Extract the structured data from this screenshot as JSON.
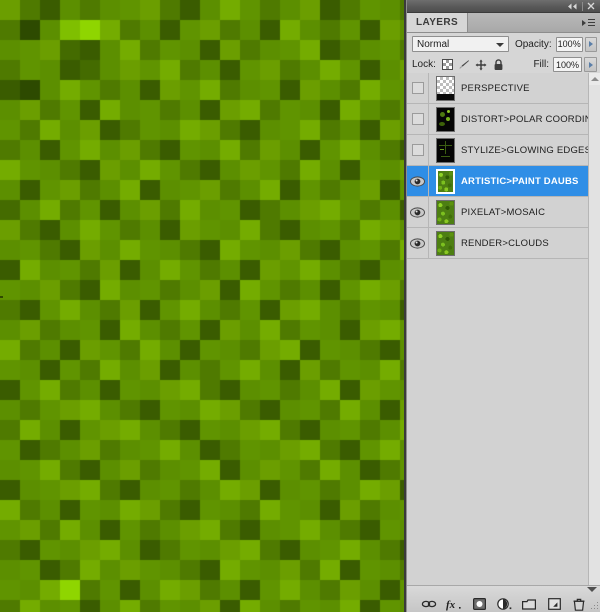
{
  "window": {
    "collapse_icon": "double-left-arrow",
    "close_icon": "close-x"
  },
  "panel": {
    "tab_label": "LAYERS",
    "menu_icon": "panel-menu-icon",
    "blend_mode": "Normal",
    "blend_dropdown_icon": "chevron-down-icon",
    "opacity_label": "Opacity:",
    "opacity_value": "100%",
    "opacity_stepper_icon": "chevron-right-icon",
    "fill_label": "Fill:",
    "fill_value": "100%",
    "fill_stepper_icon": "chevron-right-icon",
    "lock_label": "Lock:",
    "lock_icons": [
      "lock-transparent-pixels-icon",
      "lock-image-pixels-icon",
      "lock-position-icon",
      "lock-all-icon"
    ]
  },
  "layers": [
    {
      "name": "PERSPECTIVE",
      "visible": false,
      "selected": false,
      "thumb": "checker"
    },
    {
      "name": "DISTORT>POLAR COORDINA...",
      "visible": false,
      "selected": false,
      "thumb": "polar"
    },
    {
      "name": "STYLIZE>GLOWING EDGES",
      "visible": false,
      "selected": false,
      "thumb": "glow"
    },
    {
      "name": "ARTISTIC>PAINT DAUBS",
      "visible": true,
      "selected": true,
      "thumb": "green"
    },
    {
      "name": "PIXELAT>MOSAIC",
      "visible": true,
      "selected": false,
      "thumb": "green"
    },
    {
      "name": "RENDER>CLOUDS",
      "visible": true,
      "selected": false,
      "thumb": "green"
    }
  ],
  "bottom_toolbar": {
    "items": [
      "link-layers-icon",
      "layer-style-fx-icon",
      "layer-mask-icon",
      "adjustment-layer-icon",
      "new-group-icon",
      "new-layer-icon",
      "delete-layer-icon"
    ]
  },
  "colors": {
    "selection_blue": "#2f8ee6",
    "panel_bg": "#d6d6d6",
    "list_bg": "#d2d2d2",
    "topbar_dark": "#595959"
  },
  "canvas": {
    "name": "mosaic-image",
    "cell_size": 20,
    "cols": 21,
    "rows": 31,
    "palette": [
      "#6b9e00",
      "#4f7a00",
      "#3a5c00",
      "#7fbf00",
      "#8fd500",
      "#5c8f00",
      "#2d4a00",
      "#74ac00",
      "#446b00",
      "#609400",
      "#86c900",
      "#33520a",
      "#567f00",
      "#6fa300",
      "#90d91a",
      "#2a4400"
    ],
    "grid": [
      [
        "#6b9e00",
        "#4f7a00",
        "#3a5c00",
        "#5c8f00",
        "#4f7a00",
        "#5c8f00",
        "#609400",
        "#6b9e00",
        "#4f7a00",
        "#3a5c00",
        "#5c8f00",
        "#74ac00",
        "#609400",
        "#4f7a00",
        "#5c8f00",
        "#6b9e00",
        "#3a5c00",
        "#4f7a00",
        "#609400",
        "#5c8f00",
        "#4f7a00"
      ],
      [
        "#4f7a00",
        "#2d4a00",
        "#5c8f00",
        "#7fbf00",
        "#8fd500",
        "#74ac00",
        "#4f7a00",
        "#5c8f00",
        "#3a5c00",
        "#609400",
        "#6b9e00",
        "#4f7a00",
        "#5c8f00",
        "#3a5c00",
        "#74ac00",
        "#5c8f00",
        "#4f7a00",
        "#609400",
        "#3a5c00",
        "#6b9e00",
        "#5c8f00"
      ],
      [
        "#5c8f00",
        "#609400",
        "#6b9e00",
        "#446b00",
        "#3a5c00",
        "#5c8f00",
        "#74ac00",
        "#4f7a00",
        "#609400",
        "#5c8f00",
        "#3a5c00",
        "#6b9e00",
        "#4f7a00",
        "#5c8f00",
        "#609400",
        "#74ac00",
        "#3a5c00",
        "#4f7a00",
        "#5c8f00",
        "#609400",
        "#4f7a00"
      ],
      [
        "#4f7a00",
        "#609400",
        "#5c8f00",
        "#3a5c00",
        "#446b00",
        "#5c8f00",
        "#6b9e00",
        "#609400",
        "#74ac00",
        "#4f7a00",
        "#5c8f00",
        "#3a5c00",
        "#609400",
        "#6b9e00",
        "#4f7a00",
        "#5c8f00",
        "#74ac00",
        "#609400",
        "#3a5c00",
        "#5c8f00",
        "#6b9e00"
      ],
      [
        "#3a5c00",
        "#2d4a00",
        "#5c8f00",
        "#74ac00",
        "#609400",
        "#4f7a00",
        "#5c8f00",
        "#3a5c00",
        "#6b9e00",
        "#609400",
        "#74ac00",
        "#4f7a00",
        "#5c8f00",
        "#609400",
        "#3a5c00",
        "#6b9e00",
        "#5c8f00",
        "#4f7a00",
        "#74ac00",
        "#609400",
        "#5c8f00"
      ],
      [
        "#5c8f00",
        "#6b9e00",
        "#4f7a00",
        "#609400",
        "#3a5c00",
        "#74ac00",
        "#5c8f00",
        "#609400",
        "#4f7a00",
        "#5c8f00",
        "#3a5c00",
        "#6b9e00",
        "#74ac00",
        "#4f7a00",
        "#609400",
        "#5c8f00",
        "#3a5c00",
        "#74ac00",
        "#5c8f00",
        "#4f7a00",
        "#609400"
      ],
      [
        "#609400",
        "#4f7a00",
        "#74ac00",
        "#5c8f00",
        "#6b9e00",
        "#3a5c00",
        "#4f7a00",
        "#609400",
        "#5c8f00",
        "#74ac00",
        "#6b9e00",
        "#4f7a00",
        "#3a5c00",
        "#5c8f00",
        "#609400",
        "#74ac00",
        "#4f7a00",
        "#5c8f00",
        "#3a5c00",
        "#6b9e00",
        "#5c8f00"
      ],
      [
        "#4f7a00",
        "#5c8f00",
        "#3a5c00",
        "#609400",
        "#74ac00",
        "#5c8f00",
        "#6b9e00",
        "#4f7a00",
        "#3a5c00",
        "#609400",
        "#5c8f00",
        "#74ac00",
        "#4f7a00",
        "#6b9e00",
        "#5c8f00",
        "#3a5c00",
        "#609400",
        "#74ac00",
        "#5c8f00",
        "#4f7a00",
        "#3a5c00"
      ],
      [
        "#74ac00",
        "#609400",
        "#5c8f00",
        "#4f7a00",
        "#3a5c00",
        "#6b9e00",
        "#5c8f00",
        "#74ac00",
        "#609400",
        "#4f7a00",
        "#3a5c00",
        "#5c8f00",
        "#6b9e00",
        "#609400",
        "#4f7a00",
        "#74ac00",
        "#5c8f00",
        "#3a5c00",
        "#609400",
        "#5c8f00",
        "#6b9e00"
      ],
      [
        "#5c8f00",
        "#3a5c00",
        "#609400",
        "#6b9e00",
        "#4f7a00",
        "#5c8f00",
        "#74ac00",
        "#3a5c00",
        "#5c8f00",
        "#609400",
        "#6b9e00",
        "#4f7a00",
        "#5c8f00",
        "#74ac00",
        "#3a5c00",
        "#609400",
        "#4f7a00",
        "#5c8f00",
        "#6b9e00",
        "#3a5c00",
        "#609400"
      ],
      [
        "#446b00",
        "#5c8f00",
        "#74ac00",
        "#4f7a00",
        "#609400",
        "#3a5c00",
        "#5c8f00",
        "#6b9e00",
        "#4f7a00",
        "#74ac00",
        "#5c8f00",
        "#609400",
        "#3a5c00",
        "#4f7a00",
        "#5c8f00",
        "#6b9e00",
        "#74ac00",
        "#609400",
        "#4f7a00",
        "#5c8f00",
        "#3a5c00"
      ],
      [
        "#6b9e00",
        "#4f7a00",
        "#3a5c00",
        "#5c8f00",
        "#74ac00",
        "#609400",
        "#4f7a00",
        "#5c8f00",
        "#3a5c00",
        "#6b9e00",
        "#609400",
        "#5c8f00",
        "#74ac00",
        "#4f7a00",
        "#3a5c00",
        "#5c8f00",
        "#609400",
        "#4f7a00",
        "#74ac00",
        "#6b9e00",
        "#5c8f00"
      ],
      [
        "#5c8f00",
        "#609400",
        "#4f7a00",
        "#3a5c00",
        "#6b9e00",
        "#5c8f00",
        "#74ac00",
        "#609400",
        "#5c8f00",
        "#4f7a00",
        "#3a5c00",
        "#74ac00",
        "#609400",
        "#5c8f00",
        "#6b9e00",
        "#4f7a00",
        "#3a5c00",
        "#5c8f00",
        "#609400",
        "#4f7a00",
        "#74ac00"
      ],
      [
        "#3a5c00",
        "#74ac00",
        "#5c8f00",
        "#609400",
        "#4f7a00",
        "#6b9e00",
        "#3a5c00",
        "#5c8f00",
        "#74ac00",
        "#609400",
        "#4f7a00",
        "#5c8f00",
        "#3a5c00",
        "#6b9e00",
        "#609400",
        "#74ac00",
        "#5c8f00",
        "#4f7a00",
        "#3a5c00",
        "#5c8f00",
        "#609400"
      ],
      [
        "#609400",
        "#5c8f00",
        "#6b9e00",
        "#4f7a00",
        "#3a5c00",
        "#74ac00",
        "#5c8f00",
        "#609400",
        "#4f7a00",
        "#5c8f00",
        "#6b9e00",
        "#3a5c00",
        "#74ac00",
        "#609400",
        "#4f7a00",
        "#5c8f00",
        "#3a5c00",
        "#609400",
        "#74ac00",
        "#6b9e00",
        "#4f7a00"
      ],
      [
        "#4f7a00",
        "#3a5c00",
        "#609400",
        "#74ac00",
        "#5c8f00",
        "#4f7a00",
        "#6b9e00",
        "#3a5c00",
        "#609400",
        "#74ac00",
        "#5c8f00",
        "#4f7a00",
        "#609400",
        "#3a5c00",
        "#6b9e00",
        "#74ac00",
        "#5c8f00",
        "#4f7a00",
        "#609400",
        "#5c8f00",
        "#3a5c00"
      ],
      [
        "#5c8f00",
        "#6b9e00",
        "#4f7a00",
        "#5c8f00",
        "#609400",
        "#3a5c00",
        "#74ac00",
        "#5c8f00",
        "#4f7a00",
        "#609400",
        "#3a5c00",
        "#6b9e00",
        "#5c8f00",
        "#74ac00",
        "#4f7a00",
        "#609400",
        "#5c8f00",
        "#3a5c00",
        "#6b9e00",
        "#74ac00",
        "#609400"
      ],
      [
        "#74ac00",
        "#4f7a00",
        "#5c8f00",
        "#3a5c00",
        "#6b9e00",
        "#609400",
        "#4f7a00",
        "#74ac00",
        "#5c8f00",
        "#3a5c00",
        "#609400",
        "#5c8f00",
        "#4f7a00",
        "#6b9e00",
        "#74ac00",
        "#3a5c00",
        "#609400",
        "#5c8f00",
        "#4f7a00",
        "#3a5c00",
        "#5c8f00"
      ],
      [
        "#609400",
        "#5c8f00",
        "#3a5c00",
        "#609400",
        "#4f7a00",
        "#74ac00",
        "#5c8f00",
        "#6b9e00",
        "#3a5c00",
        "#5c8f00",
        "#4f7a00",
        "#609400",
        "#74ac00",
        "#5c8f00",
        "#3a5c00",
        "#6b9e00",
        "#4f7a00",
        "#609400",
        "#5c8f00",
        "#74ac00",
        "#4f7a00"
      ],
      [
        "#3a5c00",
        "#609400",
        "#74ac00",
        "#4f7a00",
        "#5c8f00",
        "#3a5c00",
        "#609400",
        "#5c8f00",
        "#6b9e00",
        "#74ac00",
        "#4f7a00",
        "#3a5c00",
        "#5c8f00",
        "#609400",
        "#4f7a00",
        "#5c8f00",
        "#74ac00",
        "#3a5c00",
        "#6b9e00",
        "#609400",
        "#5c8f00"
      ],
      [
        "#5c8f00",
        "#4f7a00",
        "#609400",
        "#6b9e00",
        "#74ac00",
        "#5c8f00",
        "#4f7a00",
        "#3a5c00",
        "#609400",
        "#5c8f00",
        "#74ac00",
        "#6b9e00",
        "#4f7a00",
        "#3a5c00",
        "#5c8f00",
        "#609400",
        "#4f7a00",
        "#74ac00",
        "#5c8f00",
        "#3a5c00",
        "#6b9e00"
      ],
      [
        "#4f7a00",
        "#74ac00",
        "#5c8f00",
        "#3a5c00",
        "#609400",
        "#6b9e00",
        "#74ac00",
        "#5c8f00",
        "#4f7a00",
        "#3a5c00",
        "#609400",
        "#5c8f00",
        "#6b9e00",
        "#74ac00",
        "#4f7a00",
        "#3a5c00",
        "#5c8f00",
        "#609400",
        "#4f7a00",
        "#5c8f00",
        "#74ac00"
      ],
      [
        "#609400",
        "#3a5c00",
        "#4f7a00",
        "#5c8f00",
        "#6b9e00",
        "#4f7a00",
        "#5c8f00",
        "#609400",
        "#74ac00",
        "#5c8f00",
        "#3a5c00",
        "#4f7a00",
        "#609400",
        "#5c8f00",
        "#6b9e00",
        "#74ac00",
        "#4f7a00",
        "#3a5c00",
        "#609400",
        "#74ac00",
        "#5c8f00"
      ],
      [
        "#5c8f00",
        "#609400",
        "#74ac00",
        "#4f7a00",
        "#3a5c00",
        "#5c8f00",
        "#6b9e00",
        "#4f7a00",
        "#5c8f00",
        "#609400",
        "#74ac00",
        "#3a5c00",
        "#5c8f00",
        "#6b9e00",
        "#609400",
        "#4f7a00",
        "#74ac00",
        "#5c8f00",
        "#3a5c00",
        "#4f7a00",
        "#609400"
      ],
      [
        "#3a5c00",
        "#5c8f00",
        "#609400",
        "#6b9e00",
        "#74ac00",
        "#4f7a00",
        "#3a5c00",
        "#5c8f00",
        "#609400",
        "#4f7a00",
        "#5c8f00",
        "#74ac00",
        "#6b9e00",
        "#3a5c00",
        "#5c8f00",
        "#609400",
        "#4f7a00",
        "#5c8f00",
        "#74ac00",
        "#6b9e00",
        "#3a5c00"
      ],
      [
        "#74ac00",
        "#4f7a00",
        "#5c8f00",
        "#3a5c00",
        "#609400",
        "#5c8f00",
        "#74ac00",
        "#6b9e00",
        "#4f7a00",
        "#3a5c00",
        "#609400",
        "#5c8f00",
        "#4f7a00",
        "#74ac00",
        "#609400",
        "#5c8f00",
        "#3a5c00",
        "#6b9e00",
        "#4f7a00",
        "#5c8f00",
        "#609400"
      ],
      [
        "#609400",
        "#6b9e00",
        "#4f7a00",
        "#74ac00",
        "#5c8f00",
        "#3a5c00",
        "#609400",
        "#4f7a00",
        "#5c8f00",
        "#6b9e00",
        "#74ac00",
        "#4f7a00",
        "#3a5c00",
        "#5c8f00",
        "#609400",
        "#74ac00",
        "#5c8f00",
        "#4f7a00",
        "#3a5c00",
        "#609400",
        "#5c8f00"
      ],
      [
        "#4f7a00",
        "#3a5c00",
        "#609400",
        "#5c8f00",
        "#6b9e00",
        "#74ac00",
        "#5c8f00",
        "#3a5c00",
        "#4f7a00",
        "#609400",
        "#5c8f00",
        "#6b9e00",
        "#74ac00",
        "#4f7a00",
        "#3a5c00",
        "#5c8f00",
        "#609400",
        "#74ac00",
        "#5c8f00",
        "#4f7a00",
        "#3a5c00"
      ],
      [
        "#5c8f00",
        "#609400",
        "#3a5c00",
        "#4f7a00",
        "#74ac00",
        "#5c8f00",
        "#6b9e00",
        "#609400",
        "#5c8f00",
        "#4f7a00",
        "#3a5c00",
        "#74ac00",
        "#609400",
        "#5c8f00",
        "#6b9e00",
        "#4f7a00",
        "#74ac00",
        "#3a5c00",
        "#609400",
        "#5c8f00",
        "#4f7a00"
      ],
      [
        "#609400",
        "#5c8f00",
        "#74ac00",
        "#8fd500",
        "#4f7a00",
        "#609400",
        "#3a5c00",
        "#5c8f00",
        "#74ac00",
        "#6b9e00",
        "#4f7a00",
        "#5c8f00",
        "#3a5c00",
        "#609400",
        "#74ac00",
        "#5c8f00",
        "#4f7a00",
        "#6b9e00",
        "#5c8f00",
        "#3a5c00",
        "#609400"
      ],
      [
        "#4f7a00",
        "#74ac00",
        "#5c8f00",
        "#609400",
        "#3a5c00",
        "#5c8f00",
        "#74ac00",
        "#4f7a00",
        "#609400",
        "#5c8f00",
        "#6b9e00",
        "#3a5c00",
        "#74ac00",
        "#5c8f00",
        "#4f7a00",
        "#609400",
        "#5c8f00",
        "#74ac00",
        "#3a5c00",
        "#609400",
        "#5c8f00"
      ]
    ]
  }
}
